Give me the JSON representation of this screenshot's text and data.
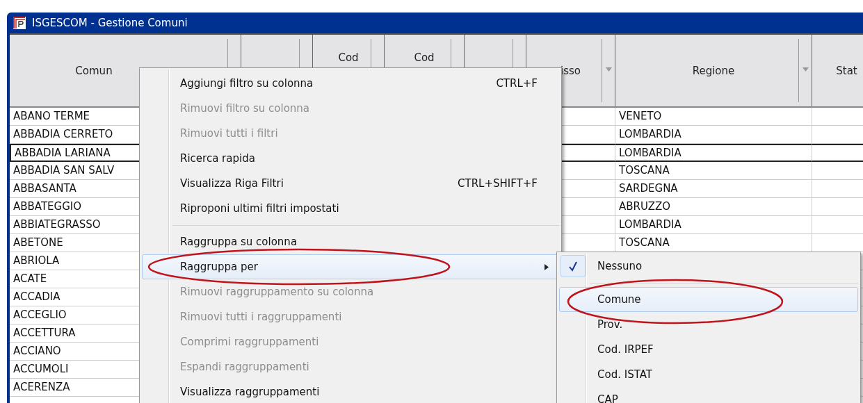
{
  "window": {
    "title": "ISGESCOM - Gestione Comuni"
  },
  "table": {
    "columns": [
      {
        "label": "Comun"
      },
      {},
      {
        "label": "Cod"
      },
      {
        "label": "Cod"
      },
      {},
      {
        "label": "isso",
        "filter": true
      },
      {
        "label": "Regione",
        "filter": true
      },
      {
        "label": "Stat"
      }
    ],
    "rows": [
      {
        "comune": "ABANO TERME",
        "regione": "VENETO",
        "selected": false
      },
      {
        "comune": "ABBADIA CERRETO",
        "regione": "LOMBARDIA",
        "selected": false
      },
      {
        "comune": "ABBADIA LARIANA",
        "regione": "LOMBARDIA",
        "selected": true
      },
      {
        "comune": "ABBADIA SAN SALV",
        "regione": "TOSCANA",
        "selected": false
      },
      {
        "comune": "ABBASANTA",
        "regione": "SARDEGNA",
        "selected": false
      },
      {
        "comune": "ABBATEGGIO",
        "regione": "ABRUZZO",
        "selected": false
      },
      {
        "comune": "ABBIATEGRASSO",
        "regione": "LOMBARDIA",
        "selected": false
      },
      {
        "comune": "ABETONE",
        "regione": "TOSCANA",
        "selected": false
      },
      {
        "comune": "ABRIOLA",
        "selected": false
      },
      {
        "comune": "ACATE",
        "selected": false
      },
      {
        "comune": "ACCADIA",
        "selected": false
      },
      {
        "comune": "ACCEGLIO",
        "selected": false
      },
      {
        "comune": "ACCETTURA",
        "selected": false
      },
      {
        "comune": "ACCIANO",
        "selected": false
      },
      {
        "comune": "ACCUMOLI",
        "selected": false
      },
      {
        "comune": "ACERENZA",
        "selected": false
      }
    ]
  },
  "context_menu": {
    "items": [
      {
        "kind": "item",
        "label": "Aggiungi filtro su colonna",
        "shortcut": "CTRL+F",
        "disabled": false,
        "highlighted": false,
        "submenu": false
      },
      {
        "kind": "item",
        "label": "Rimuovi filtro su colonna",
        "disabled": true,
        "highlighted": false,
        "submenu": false
      },
      {
        "kind": "item",
        "label": "Rimuovi tutti i filtri",
        "disabled": true,
        "highlighted": false,
        "submenu": false
      },
      {
        "kind": "item",
        "label": "Ricerca rapida",
        "disabled": false,
        "highlighted": false,
        "submenu": false
      },
      {
        "kind": "item",
        "label": "Visualizza Riga Filtri",
        "shortcut": "CTRL+SHIFT+F",
        "disabled": false,
        "highlighted": false,
        "submenu": false
      },
      {
        "kind": "item",
        "label": "Riproponi ultimi filtri impostati",
        "disabled": false,
        "highlighted": false,
        "submenu": false
      },
      {
        "kind": "separator"
      },
      {
        "kind": "item",
        "label": "Raggruppa su colonna",
        "disabled": false,
        "highlighted": false,
        "submenu": false
      },
      {
        "kind": "item",
        "label": "Raggruppa per",
        "disabled": false,
        "highlighted": true,
        "submenu": true
      },
      {
        "kind": "item",
        "label": "Rimuovi raggruppamento su colonna",
        "disabled": true,
        "highlighted": false,
        "submenu": false
      },
      {
        "kind": "item",
        "label": "Rimuovi tutti i raggruppamenti",
        "disabled": true,
        "highlighted": false,
        "submenu": false
      },
      {
        "kind": "item",
        "label": "Comprimi raggruppamenti",
        "disabled": true,
        "highlighted": false,
        "submenu": false
      },
      {
        "kind": "item",
        "label": "Espandi raggruppamenti",
        "disabled": true,
        "highlighted": false,
        "submenu": false
      },
      {
        "kind": "item",
        "label": "Visualizza raggruppamenti",
        "disabled": false,
        "highlighted": false,
        "submenu": false
      }
    ]
  },
  "submenu": {
    "items": [
      {
        "kind": "item",
        "label": "Nessuno",
        "checked": true,
        "highlighted": false
      },
      {
        "kind": "separator"
      },
      {
        "kind": "item",
        "label": "Comune",
        "checked": false,
        "highlighted": true
      },
      {
        "kind": "item",
        "label": "Prov.",
        "checked": false,
        "highlighted": false
      },
      {
        "kind": "item",
        "label": "Cod. IRPEF",
        "checked": false,
        "highlighted": false
      },
      {
        "kind": "item",
        "label": "Cod. ISTAT",
        "checked": false,
        "highlighted": false
      },
      {
        "kind": "item",
        "label": "CAP",
        "checked": false,
        "highlighted": false
      }
    ]
  }
}
